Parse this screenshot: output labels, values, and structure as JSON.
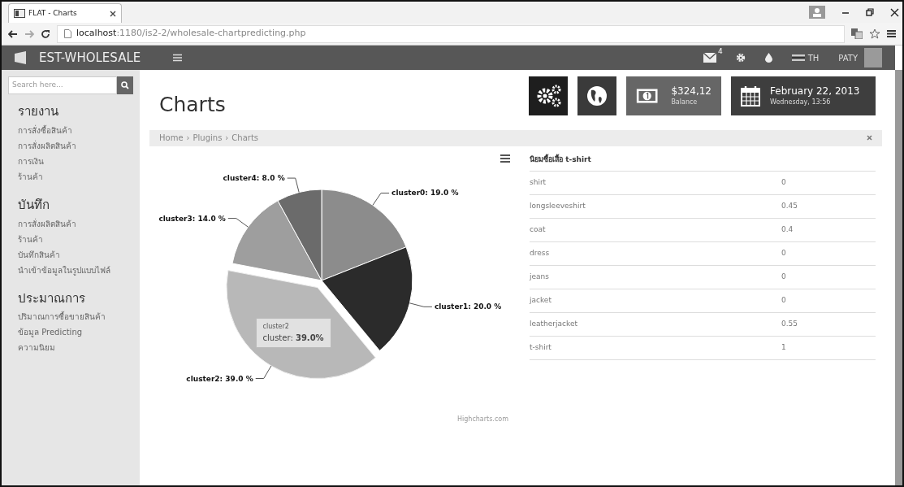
{
  "browser": {
    "tab_title": "FLAT - Charts",
    "url_host": "localhost",
    "url_path": ":1180/is2-2/wholesale-chartpredicting.php"
  },
  "navbar": {
    "brand": "EST-WHOLESALE",
    "message_count": "4",
    "language": "TH",
    "user": "PATY"
  },
  "sidebar": {
    "search_placeholder": "Search here...",
    "sections": [
      {
        "heading": "รายงาน",
        "items": [
          "การสั่งซื้อสินค้า",
          "การสั่งผลิตสินค้า",
          "การเงิน",
          "ร้านค้า"
        ]
      },
      {
        "heading": "บันทึก",
        "items": [
          "การสั่งผลิตสินค้า",
          "ร้านค้า",
          "บันทึกสินค้า",
          "นำเข้าข้อมูลในรูปแบบไฟล์"
        ]
      },
      {
        "heading": "ประมาณการ",
        "items": [
          "ปริมาณการซื้อขายสินค้า",
          "ข้อมูล Predicting",
          "ความนิยม"
        ]
      }
    ]
  },
  "page": {
    "title": "Charts",
    "balance": {
      "amount": "$324,12",
      "label": "Balance"
    },
    "date": {
      "main": "February 22, 2013",
      "sub": "Wednesday, 13:56"
    }
  },
  "breadcrumb": {
    "items": [
      "Home",
      "Plugins",
      "Charts"
    ],
    "separator": "›"
  },
  "chart": {
    "slices": [
      {
        "color": "#8c8c8c",
        "sliced": false,
        "tooltip": false
      },
      {
        "color": "#2b2b2b",
        "sliced": false,
        "tooltip": false
      },
      {
        "color": "#b8b8b8",
        "sliced": true,
        "tooltip": true
      },
      {
        "color": "#9e9e9e",
        "sliced": false,
        "tooltip": false
      },
      {
        "color": "#6b6b6b",
        "sliced": false,
        "tooltip": false
      }
    ],
    "chart_data": {
      "type": "pie",
      "series": [
        {
          "values": [
            19,
            20,
            39,
            14,
            8
          ]
        }
      ],
      "value_labels": [
        "cluster0: 19.0 %",
        "cluster1: 20.0 %",
        "cluster2: 39.0 %",
        "cluster3: 14.0 %",
        "cluster4: 8.0 %"
      ]
    },
    "tooltip": {
      "title": "cluster2",
      "text": "cluster: **39.0%**"
    },
    "credit": "Highcharts.com"
  },
  "table": {
    "header": "นิยมซื้อเสื้อ t-shirt",
    "rows": [
      {
        "name": "shirt",
        "value": "0"
      },
      {
        "name": "longsleeveshirt",
        "value": "0.45"
      },
      {
        "name": "coat",
        "value": "0.4"
      },
      {
        "name": "dress",
        "value": "0"
      },
      {
        "name": "jeans",
        "value": "0"
      },
      {
        "name": "jacket",
        "value": "0"
      },
      {
        "name": "leatherjacket",
        "value": "0.55"
      },
      {
        "name": "t-shirt",
        "value": "1"
      }
    ]
  }
}
